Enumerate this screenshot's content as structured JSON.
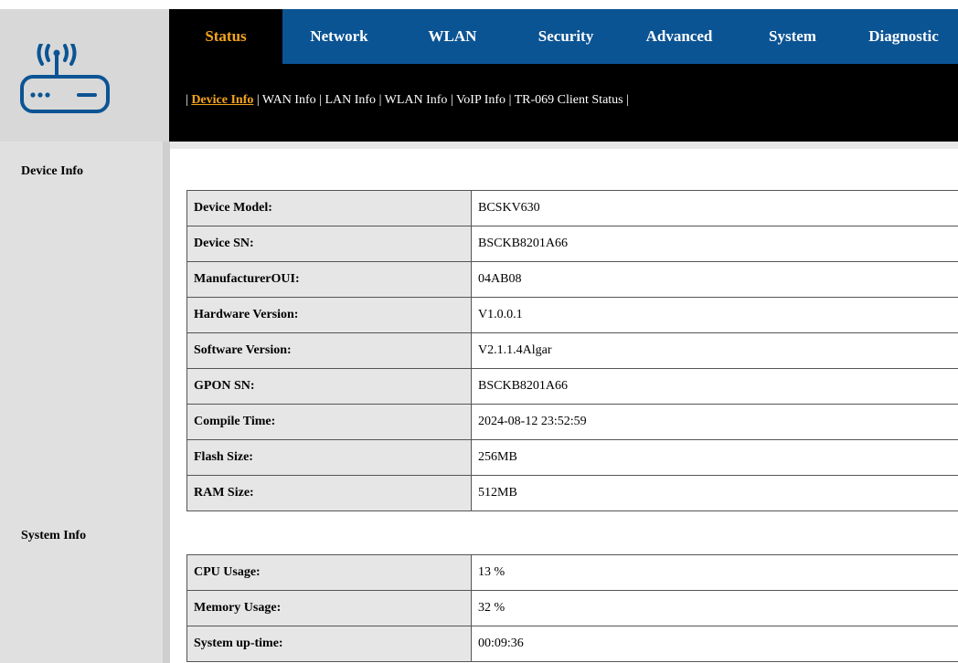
{
  "nav": {
    "tabs": [
      {
        "label": "Status",
        "active": true
      },
      {
        "label": "Network",
        "active": false
      },
      {
        "label": "WLAN",
        "active": false
      },
      {
        "label": "Security",
        "active": false
      },
      {
        "label": "Advanced",
        "active": false
      },
      {
        "label": "System",
        "active": false
      },
      {
        "label": "Diagnostic",
        "active": false
      }
    ]
  },
  "subnav": {
    "items": [
      {
        "label": "Device Info",
        "active": true
      },
      {
        "label": "WAN Info",
        "active": false
      },
      {
        "label": "LAN Info",
        "active": false
      },
      {
        "label": "WLAN Info",
        "active": false
      },
      {
        "label": "VoIP Info",
        "active": false
      },
      {
        "label": "TR-069 Client Status",
        "active": false
      }
    ],
    "separator": "|"
  },
  "sidebar": {
    "device_info_label": "Device Info",
    "system_info_label": "System Info"
  },
  "device_info": {
    "rows": [
      {
        "label": "Device Model:",
        "value": "BCSKV630"
      },
      {
        "label": "Device SN:",
        "value": "BSCKB8201A66"
      },
      {
        "label": "ManufacturerOUI:",
        "value": "04AB08"
      },
      {
        "label": "Hardware Version:",
        "value": "V1.0.0.1"
      },
      {
        "label": "Software Version:",
        "value": "V2.1.1.4Algar"
      },
      {
        "label": "GPON SN:",
        "value": "BSCKB8201A66"
      },
      {
        "label": "Compile Time:",
        "value": "2024-08-12 23:52:59"
      },
      {
        "label": "Flash Size:",
        "value": "256MB"
      },
      {
        "label": "RAM Size:",
        "value": "512MB"
      }
    ]
  },
  "system_info": {
    "rows": [
      {
        "label": "CPU Usage:",
        "value": "13 %"
      },
      {
        "label": "Memory Usage:",
        "value": "32 %"
      },
      {
        "label": "System up-time:",
        "value": "00:09:36"
      }
    ]
  },
  "colors": {
    "nav_blue": "#0b5494",
    "accent_orange": "#f5a41c",
    "sidebar_gray": "#e0e0e0"
  },
  "logo": {
    "icon": "router-wifi-icon"
  }
}
